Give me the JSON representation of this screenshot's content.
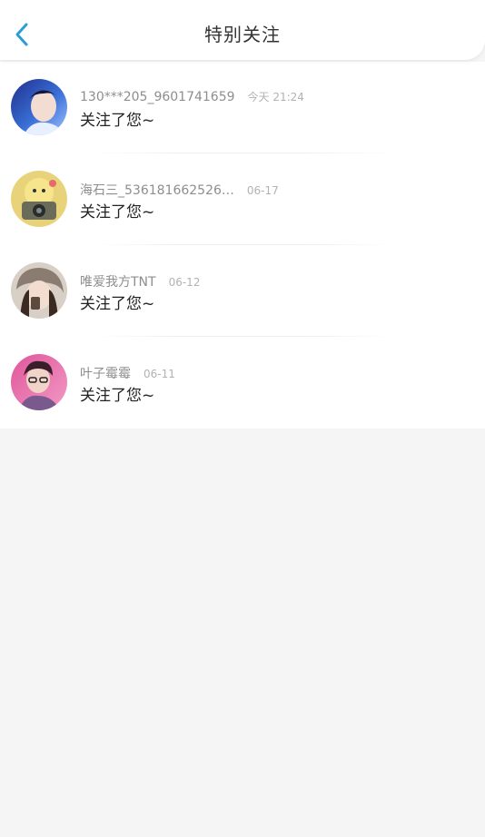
{
  "header": {
    "title": "特别关注",
    "back_icon": "chevron-left-icon",
    "accent_color": "#2a9fd6"
  },
  "items": [
    {
      "name": "130***205_9601741659",
      "time": "今天 21:24",
      "message": "关注了您~"
    },
    {
      "name": "海石三_536181662526…",
      "time": "06-17",
      "message": "关注了您~"
    },
    {
      "name": "唯爱我方TNT",
      "time": "06-12",
      "message": "关注了您~"
    },
    {
      "name": "叶子霉霉",
      "time": "06-11",
      "message": "关注了您~"
    }
  ]
}
